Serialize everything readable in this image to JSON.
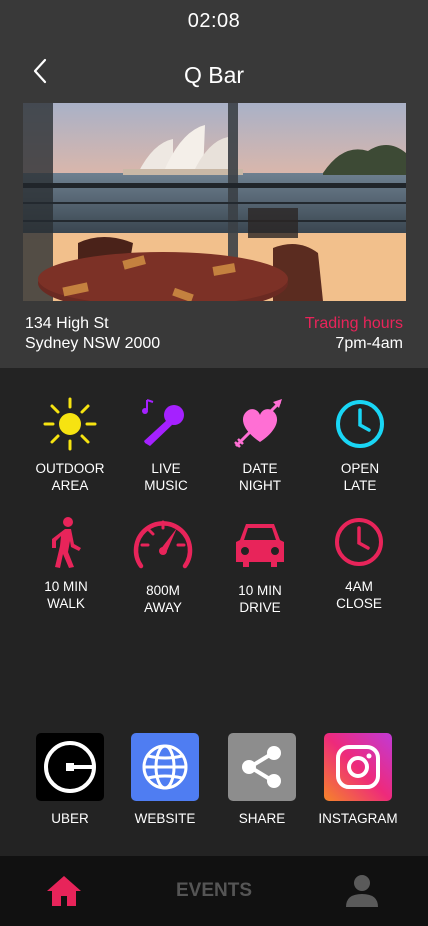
{
  "status": {
    "time": "02:08"
  },
  "header": {
    "title": "Q Bar",
    "back_icon": "chevron-left-icon"
  },
  "venue": {
    "address_line1": "134 High St",
    "address_line2": "Sydney NSW 2000",
    "hours_label": "Trading hours",
    "hours_value": "7pm-4am"
  },
  "features": [
    {
      "icon": "sun-icon",
      "line1": "OUTDOOR",
      "line2": "AREA",
      "color": "#f6e311"
    },
    {
      "icon": "microphone-icon",
      "line1": "LIVE",
      "line2": "MUSIC",
      "color": "#a521ff"
    },
    {
      "icon": "heart-arrow-icon",
      "line1": "DATE",
      "line2": "NIGHT",
      "color": "#ff6fd4"
    },
    {
      "icon": "clock-icon",
      "line1": "OPEN",
      "line2": "LATE",
      "color": "#19d6f5"
    },
    {
      "icon": "walking-icon",
      "line1": "10 MIN",
      "line2": "WALK",
      "color": "#e8245a"
    },
    {
      "icon": "speedometer-icon",
      "line1": "800M",
      "line2": "AWAY",
      "color": "#e8245a"
    },
    {
      "icon": "car-icon",
      "line1": "10 MIN",
      "line2": "DRIVE",
      "color": "#e8245a"
    },
    {
      "icon": "clock-icon",
      "line1": "4AM",
      "line2": "CLOSE",
      "color": "#e8245a"
    }
  ],
  "apps": [
    {
      "icon": "uber-icon",
      "label": "UBER",
      "bg": "#000000"
    },
    {
      "icon": "globe-icon",
      "label": "WEBSITE",
      "bg": "#4f7df2"
    },
    {
      "icon": "share-icon",
      "label": "SHARE",
      "bg": "#8d8d8d"
    },
    {
      "icon": "instagram-icon",
      "label": "INSTAGRAM",
      "bg": "#e1306c"
    }
  ],
  "nav": {
    "home_icon": "home-icon",
    "events_label": "EVENTS",
    "profile_icon": "user-icon",
    "active_color": "#e8245a"
  }
}
